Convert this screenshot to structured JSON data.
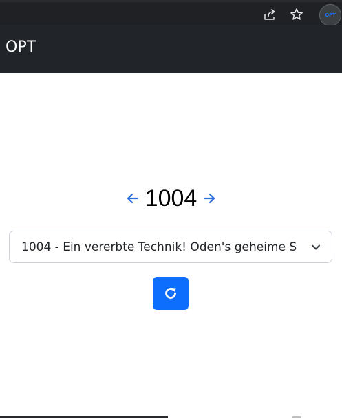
{
  "browser": {
    "icons": [
      "share-icon",
      "star-icon"
    ],
    "profile_label": "OPT",
    "profile_color": "#1a73e8"
  },
  "navbar": {
    "brand": "OPT",
    "background": "#212529"
  },
  "episode": {
    "number": "1004",
    "prev_icon": "arrow-left-icon",
    "next_icon": "arrow-right-icon",
    "arrow_color": "#2f6fde"
  },
  "select": {
    "value": "1004 - Ein vererbte Technik! Oden's geheime S",
    "icon": "chevron-down-icon"
  },
  "reload": {
    "icon": "reload-icon",
    "color": "#0d6efd"
  }
}
